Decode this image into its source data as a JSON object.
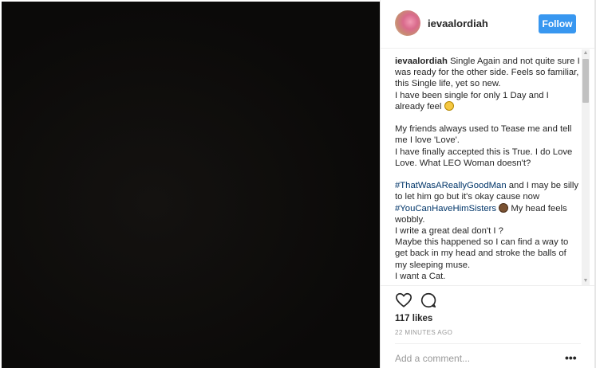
{
  "post": {
    "username": "ievaalordiah",
    "follow_label": "Follow"
  },
  "caption": {
    "username": "ievaalordiah",
    "lines": {
      "l1": " Single Again and not quite sure I was ready for the other side. Feels so familiar, this Single life, yet so new.",
      "l2": "I have been single for only 1 Day and I already feel ",
      "l3": "My friends always used to Tease me and tell me I love 'Love'.",
      "l4": "I have finally accepted this is True. I do Love Love. What LEO Woman doesn't?",
      "tag1": "#ThatWasAReallyGoodMan",
      "l5": " and I may be silly to let him go but it's okay cause now ",
      "tag2": "#YouCanHaveHimSisters",
      "l6": " My head feels wobbly.",
      "l7": "I write a great deal don't I ?",
      "l8": "Maybe this happened so I can find a way to get back in my head and stroke the balls of my sleeping muse.",
      "l9": "I want a Cat."
    },
    "emojis": [
      "grimacing-face-emoji",
      "hand-emoji"
    ]
  },
  "scrollbar": {
    "up_glyph": "▲",
    "down_glyph": "▼"
  },
  "actions": {
    "icons": [
      "heart-icon",
      "comment-icon"
    ]
  },
  "likes": "117 likes",
  "timestamp": "22 MINUTES AGO",
  "comment": {
    "placeholder": "Add a comment...",
    "value": ""
  },
  "more_label": "•••",
  "colors": {
    "accent": "#3897f0",
    "hashtag": "#003569",
    "media_bg": "#0b0a09"
  }
}
